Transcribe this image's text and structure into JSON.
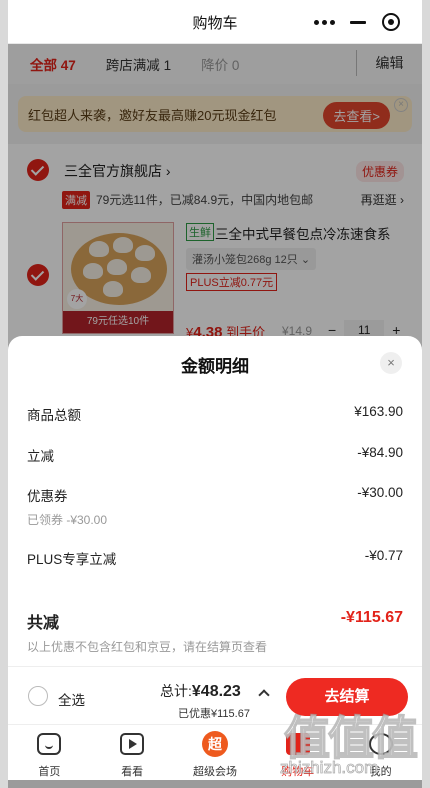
{
  "nav": {
    "title": "购物车"
  },
  "filters": {
    "all": "全部",
    "all_count": "47",
    "cross_store": "跨店满减",
    "cross_count": "1",
    "price_drop": "降价",
    "drop_count": "0",
    "edit": "编辑"
  },
  "promo": {
    "text": "红包超人来袭，邀好友最高赚20元现金红包",
    "button": "去查看>",
    "close": "×"
  },
  "store": {
    "name": "三全官方旗舰店",
    "chevron": "›",
    "coupon": "优惠券",
    "full_tag": "满减",
    "full_text": "79元选11件，已减84.9元，中国内地包邮",
    "more": "再逛逛 ›",
    "product": {
      "fresh_tag": "生鲜",
      "title": "三全中式早餐包点冷冻速食系",
      "spec": "灌汤小笼包268g 12只 ⌄",
      "plus_tag": "PLUS立减0.77元",
      "thumb_band": "79元任选10件",
      "thumb_badge": "7大",
      "price_symbol": "¥",
      "price": "4.38",
      "price_suffix": "到手价",
      "original_price": "¥14.9",
      "qty": "11",
      "minus": "−",
      "plus": "+"
    }
  },
  "sheet": {
    "title": "金额明细",
    "close": "×",
    "rows": [
      {
        "label": "商品总额",
        "value": "¥163.90"
      },
      {
        "label": "立减",
        "value": "-¥84.90"
      },
      {
        "label": "优惠券",
        "value": "-¥30.00"
      },
      {
        "label": "PLUS专享立减",
        "value": "-¥0.77"
      }
    ],
    "coupon_note": "已领券 -¥30.00",
    "total_label": "共减",
    "total_value": "-¥115.67",
    "footnote": "以上优惠不包含红包和京豆，请在结算页查看"
  },
  "checkout": {
    "select_all": "全选",
    "total_prefix": "总计:",
    "total": "¥48.23",
    "saved": "已优惠¥115.67",
    "button": "去结算"
  },
  "tabs": [
    {
      "label": "首页"
    },
    {
      "label": "看看"
    },
    {
      "label": "超级会场",
      "icon_text": "超"
    },
    {
      "label": "购物车"
    },
    {
      "label": "我的"
    }
  ],
  "watermark": {
    "big": "值值值",
    "url": "zhizhizh.com"
  },
  "colors": {
    "accent": "#e2231a",
    "promo_bg": "#fcebc8",
    "fresh": "#2e9b46"
  }
}
